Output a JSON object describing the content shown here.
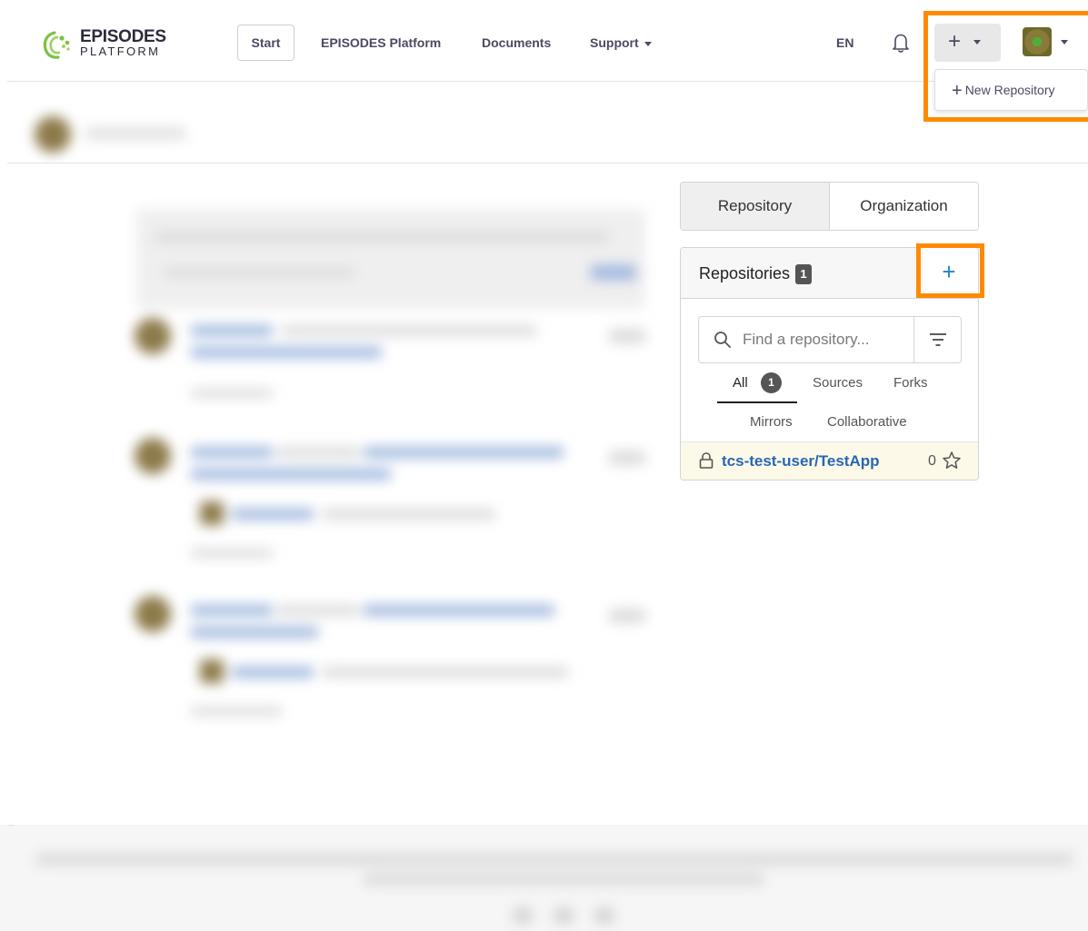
{
  "brand": {
    "name": "EPISODES",
    "sub": "PLATFORM",
    "color": "#7cc242"
  },
  "nav": {
    "start": "Start",
    "platform": "EPISODES Platform",
    "documents": "Documents",
    "support": "Support",
    "language": "EN"
  },
  "create_menu": {
    "symbol": "+",
    "items": [
      {
        "symbol": "+",
        "label": "New Repository"
      }
    ]
  },
  "tabs": [
    {
      "label": "Repository",
      "active": true
    },
    {
      "label": "Organization",
      "active": false
    }
  ],
  "repositories": {
    "title": "Repositories",
    "count": "1",
    "add_symbol": "+",
    "search_placeholder": "Find a repository...",
    "filters": [
      {
        "label": "All",
        "count": "1",
        "active": true
      },
      {
        "label": "Sources"
      },
      {
        "label": "Forks"
      },
      {
        "label": "Mirrors"
      },
      {
        "label": "Collaborative"
      }
    ],
    "items": [
      {
        "name": "tcs-test-user/TestApp",
        "private": true,
        "stars": "0"
      }
    ]
  },
  "colors": {
    "highlight": "#ff8a00",
    "link": "#2767b4",
    "accent_blue": "#2185d0"
  }
}
